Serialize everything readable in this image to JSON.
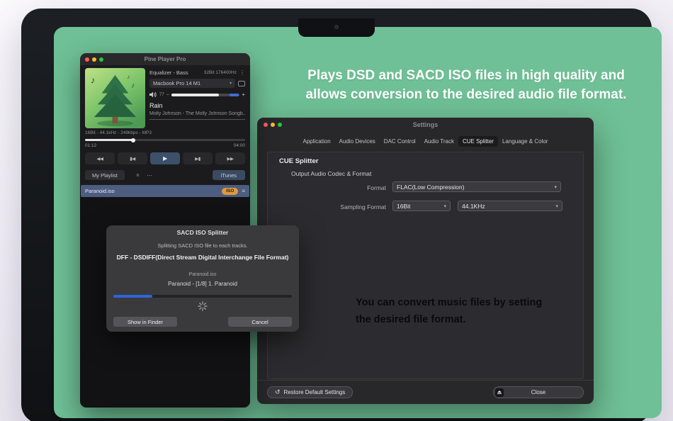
{
  "headline": {
    "line1": "Plays DSD and SACD ISO files in high quality and",
    "line2": "allows conversion to the desired audio file format."
  },
  "note": {
    "line1": "You can convert music files by setting",
    "line2": "the desired file format."
  },
  "player": {
    "window_title": "Pine Player Pro",
    "equalizer_label": "Equalizer - Bass",
    "bit_info": "32Bit  176400Hz",
    "menu_icon": "⋮",
    "output_device": "Macbook Pro 14 M1",
    "dropdown_icon": "▾",
    "volume_value": "77",
    "volume_minus": "–",
    "volume_plus": "+",
    "volume_percent": 70,
    "track_title": "Rain",
    "track_artist": "Molly Johnson - The Molly Johnson Songb...",
    "format_info": "16Bit - 44.1kHz - 249kbps - MP3",
    "time_elapsed": "01:12",
    "time_total": "04:00",
    "progress_percent": 30,
    "transport_icons": {
      "rewind": "◀◀",
      "previous": "▮◀",
      "play": "▶",
      "next": "▶▮",
      "forward": "▶▶"
    },
    "playlist_tab_label": "My Playlist",
    "collapse_icon": "∧",
    "more_icon": "⋯",
    "itunes_button": "iTunes",
    "playlist_item_name": "Paranoid.iso",
    "playlist_item_badge": "ISO",
    "list_icon": "≡"
  },
  "dialog": {
    "title": "SACD ISO Splitter",
    "message": "Splitting SACD ISO file to each tracks.",
    "format_line": "DFF - DSDIFF(Direct Stream Digital Interchange File Format)",
    "file_name": "Paranoid.iso",
    "track_line": "Paranoid - [1/8] 1. Paranoid",
    "progress_percent": 22,
    "finder_button": "Show in Finder",
    "cancel_button": "Cancel"
  },
  "settings": {
    "window_title": "Settings",
    "tabs": [
      "Application",
      "Audio Devices",
      "DAC Control",
      "Audio Track",
      "CUE Splitter",
      "Language & Color"
    ],
    "active_tab_index": 4,
    "section_title": "CUE Splitter",
    "subsection_title": "Output Audio Codec & Format",
    "format_label": "Format",
    "format_value": "FLAC(Low Compression)",
    "sampling_label": "Sampling Format",
    "sampling_bit_value": "16Bit",
    "sampling_rate_value": "44.1KHz",
    "dropdown_icon": "▾",
    "restore_icon": "↺",
    "restore_button": "Restore Default Settings",
    "close_button": "Close"
  },
  "colors": {
    "screen_green": "#6fc096",
    "accent_blue": "#2e63da",
    "badge_orange": "#dd9b3f"
  }
}
